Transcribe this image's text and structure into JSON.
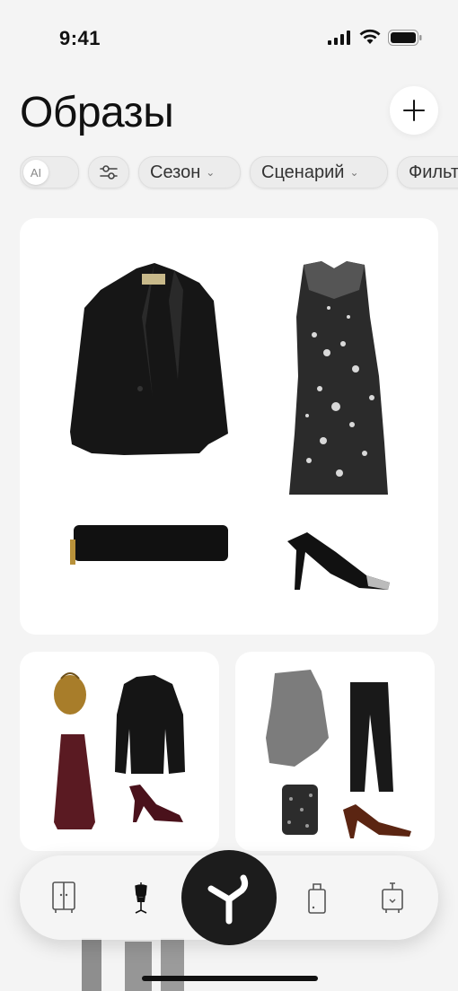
{
  "status_bar": {
    "time": "9:41"
  },
  "header": {
    "title": "Образы"
  },
  "filters": {
    "ai_label": "AI",
    "chips": [
      {
        "label": "Сезон"
      },
      {
        "label": "Сценарий"
      },
      {
        "label": "Фильтр"
      }
    ]
  },
  "outfits": [
    {
      "items": [
        "black-blazer",
        "sequin-dress",
        "velvet-clutch",
        "slingback-heels"
      ]
    },
    {
      "items": [
        "gold-pouch-bag",
        "black-cardigan",
        "burgundy-skirt",
        "burgundy-heels"
      ]
    },
    {
      "items": [
        "grey-draped-top",
        "black-trousers",
        "beaded-handbag",
        "brown-mules"
      ]
    }
  ],
  "tabbar": {
    "tabs": [
      "wardrobe-icon",
      "mannequin-icon",
      "stylist-icon",
      "suitcase-icon",
      "luggage-icon"
    ]
  },
  "colors": {
    "background": "#f4f4f4",
    "card": "#ffffff",
    "accent_dark": "#1c1c1c",
    "chip": "#ececec"
  }
}
